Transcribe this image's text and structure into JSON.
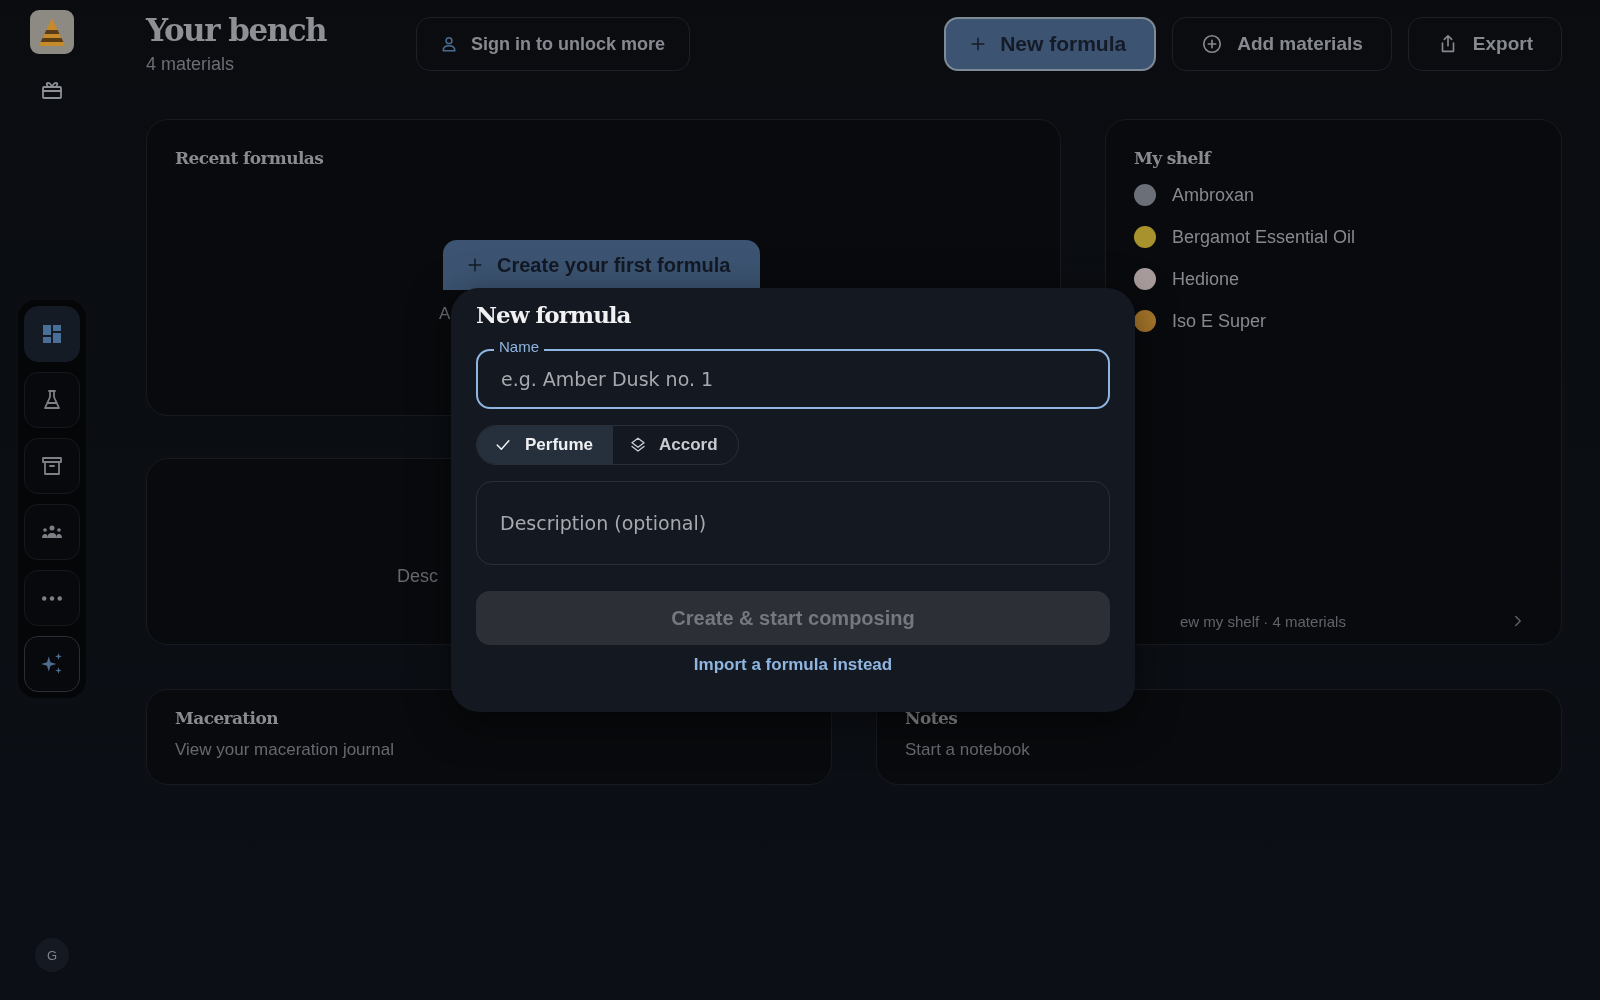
{
  "sidebar": {
    "avatar": "G",
    "nav": [
      {
        "kind": "dashboard",
        "selected": true
      },
      {
        "kind": "flask",
        "selected": false
      },
      {
        "kind": "archive",
        "selected": false
      },
      {
        "kind": "people",
        "selected": false
      },
      {
        "kind": "more",
        "selected": false
      },
      {
        "kind": "sparkle",
        "selected": false
      }
    ]
  },
  "header": {
    "title": "Your bench",
    "subtitle": "4 materials",
    "sign_in": "Sign in to unlock more",
    "actions": [
      {
        "kind": "primary",
        "label": "New formula"
      },
      {
        "kind": "outline",
        "label": "Add materials"
      },
      {
        "kind": "outline",
        "label": "Export"
      }
    ]
  },
  "recent": {
    "title": "Recent formulas",
    "create_button": "Create your first formula",
    "empty_text": "A"
  },
  "second_card": {
    "text": "Desc"
  },
  "shelf": {
    "title": "My shelf",
    "items": [
      {
        "name": "Ambroxan",
        "color": "#6b6f78"
      },
      {
        "name": "Bergamot Essential Oil",
        "color": "#a8922e"
      },
      {
        "name": "Hedione",
        "color": "#a89c9c"
      },
      {
        "name": "Iso E Super",
        "color": "#a8772a"
      }
    ],
    "footer": "ew my shelf · 4 materials"
  },
  "bottom_cards": [
    {
      "title": "Maceration",
      "text": "View your maceration journal"
    },
    {
      "title": "Notes",
      "text": "Start a notebook"
    }
  ],
  "dialog": {
    "title": "New formula",
    "name_label": "Name",
    "name_placeholder": "e.g. Amber Dusk no. 1",
    "types": [
      {
        "kind": "check",
        "label": "Perfume",
        "selected": true
      },
      {
        "kind": "layers",
        "label": "Accord",
        "selected": false
      }
    ],
    "description_placeholder": "Description (optional)",
    "submit": "Create & start composing",
    "submit_disabled": true,
    "import_link": "Import a formula instead"
  }
}
